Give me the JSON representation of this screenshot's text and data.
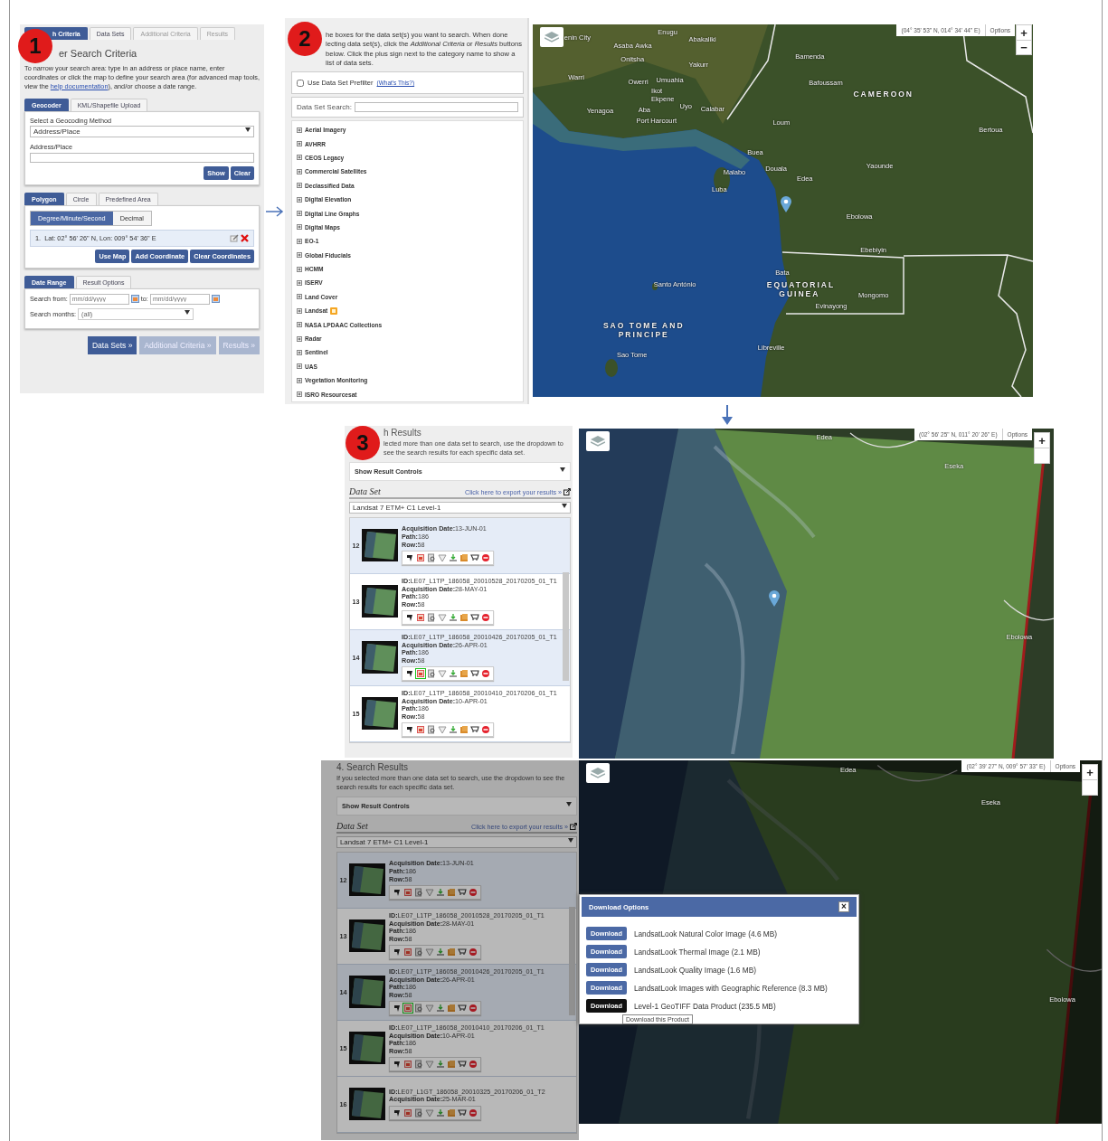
{
  "step1": {
    "badge": "1",
    "tabs": [
      {
        "label": "h Criteria",
        "selected": true,
        "disabled": false
      },
      {
        "label": "Data Sets",
        "selected": false,
        "disabled": false
      },
      {
        "label": "Additional Criteria",
        "selected": false,
        "disabled": true
      },
      {
        "label": "Results",
        "selected": false,
        "disabled": true
      }
    ],
    "title": "er Search Criteria",
    "intro_before": "To narrow your search area: type in an address or place name, enter coordinates or click the map to define your search area (for advanced map tools, view the ",
    "intro_link": "help documentation",
    "intro_after": "), and/or choose a date range.",
    "geocoder": {
      "tabs": [
        {
          "label": "Geocoder",
          "selected": true
        },
        {
          "label": "KML/Shapefile Upload",
          "selected": false
        }
      ],
      "method_label": "Select a Geocoding Method",
      "method_value": "Address/Place",
      "field_label": "Address/Place",
      "buttons": [
        "Show",
        "Clear"
      ]
    },
    "area": {
      "tabs": [
        {
          "label": "Polygon",
          "selected": true
        },
        {
          "label": "Circle",
          "selected": false
        },
        {
          "label": "Predefined Area",
          "selected": false
        }
      ],
      "formats": [
        {
          "label": "Degree/Minute/Second",
          "selected": true
        },
        {
          "label": "Decimal",
          "selected": false
        }
      ],
      "coordinates": [
        {
          "index": "1.",
          "text": "Lat: 02° 56' 26\" N, Lon: 009° 54' 36\" E"
        }
      ],
      "buttons": [
        "Use Map",
        "Add Coordinate",
        "Clear Coordinates"
      ]
    },
    "dates": {
      "tabs": [
        {
          "label": "Date Range",
          "selected": true
        },
        {
          "label": "Result Options",
          "selected": false
        }
      ],
      "from_label": "Search from:",
      "from_placeholder": "mm/dd/yyyy",
      "to_label": "to:",
      "to_placeholder": "mm/dd/yyyy",
      "months_label": "Search months:",
      "months_value": "(all)"
    },
    "nav_buttons": [
      {
        "label": "Data Sets »",
        "disabled": false
      },
      {
        "label": "Additional Criteria »",
        "disabled": true
      },
      {
        "label": "Results »",
        "disabled": true
      }
    ]
  },
  "step2": {
    "badge": "2",
    "intro": "he boxes for the data set(s) you want to search. When done lecting data set(s), click the *Additional Criteria* or *Results* buttons below. Click the plus sign next to the category name to show a list of data sets.",
    "prefilter": {
      "label": "Use Data Set Prefilter",
      "checked": false,
      "link": "(What's This?)"
    },
    "search_label": "Data Set Search:",
    "categories": [
      {
        "label": "Aerial Imagery",
        "new": false
      },
      {
        "label": "AVHRR",
        "new": false
      },
      {
        "label": "CEOS Legacy",
        "new": false
      },
      {
        "label": "Commercial Satellites",
        "new": false
      },
      {
        "label": "Declassified Data",
        "new": false
      },
      {
        "label": "Digital Elevation",
        "new": false
      },
      {
        "label": "Digital Line Graphs",
        "new": false
      },
      {
        "label": "Digital Maps",
        "new": false
      },
      {
        "label": "EO-1",
        "new": false
      },
      {
        "label": "Global Fiducials",
        "new": false
      },
      {
        "label": "HCMM",
        "new": false
      },
      {
        "label": "ISERV",
        "new": false
      },
      {
        "label": "Land Cover",
        "new": false
      },
      {
        "label": "Landsat",
        "new": true
      },
      {
        "label": "NASA LPDAAC Collections",
        "new": false
      },
      {
        "label": "Radar",
        "new": false
      },
      {
        "label": "Sentinel",
        "new": false
      },
      {
        "label": "UAS",
        "new": false
      },
      {
        "label": "Vegetation Monitoring",
        "new": false
      },
      {
        "label": "ISRO Resourcesat",
        "new": false
      }
    ],
    "map": {
      "coordinates": "(04° 35' 53\" N, 014° 34' 44\" E)",
      "options": "Options",
      "zoom_in": "+",
      "zoom_out": "−",
      "labels": [
        {
          "text": "enin City",
          "kind": "city"
        },
        {
          "text": "Enugu",
          "kind": "city"
        },
        {
          "text": "Asaba",
          "kind": "city"
        },
        {
          "text": "Awka",
          "kind": "city"
        },
        {
          "text": "Abakaliki",
          "kind": "city"
        },
        {
          "text": "Onitsha",
          "kind": "city"
        },
        {
          "text": "Yakurr",
          "kind": "city"
        },
        {
          "text": "Warri",
          "kind": "city"
        },
        {
          "text": "Owerri",
          "kind": "city"
        },
        {
          "text": "Umuahia",
          "kind": "city"
        },
        {
          "text": "Ikot Ekpene",
          "kind": "city"
        },
        {
          "text": "Uyo",
          "kind": "city"
        },
        {
          "text": "Calabar",
          "kind": "city"
        },
        {
          "text": "Yenagoa",
          "kind": "city"
        },
        {
          "text": "Aba",
          "kind": "city"
        },
        {
          "text": "Port Harcourt",
          "kind": "city"
        },
        {
          "text": "Bamenda",
          "kind": "city"
        },
        {
          "text": "Bafoussam",
          "kind": "city"
        },
        {
          "text": "CAMEROON",
          "kind": "country"
        },
        {
          "text": "Loum",
          "kind": "city"
        },
        {
          "text": "Bertoua",
          "kind": "city"
        },
        {
          "text": "Buea",
          "kind": "city"
        },
        {
          "text": "Douala",
          "kind": "city"
        },
        {
          "text": "Edea",
          "kind": "city"
        },
        {
          "text": "Malabo",
          "kind": "city"
        },
        {
          "text": "Luba",
          "kind": "city"
        },
        {
          "text": "Yaounde",
          "kind": "city"
        },
        {
          "text": "Ebolowa",
          "kind": "city"
        },
        {
          "text": "Ebebiyin",
          "kind": "city"
        },
        {
          "text": "Bata",
          "kind": "city"
        },
        {
          "text": "EQUATORIAL GUINEA",
          "kind": "country"
        },
        {
          "text": "Mongomo",
          "kind": "city"
        },
        {
          "text": "Evinayong",
          "kind": "city"
        },
        {
          "text": "Santo António",
          "kind": "city"
        },
        {
          "text": "SAO TOME AND PRINCIPE",
          "kind": "country"
        },
        {
          "text": "Sao Tome",
          "kind": "city"
        },
        {
          "text": "Libreville",
          "kind": "city"
        }
      ]
    }
  },
  "step3": {
    "results": {
      "badge": "3",
      "title": "h Results",
      "intro": "lected more than one data set to search, use the dropdown to see the search results for each specific data set.",
      "controls": "Show Result Controls",
      "dataset_label": "Data Set",
      "export_link": "Click here to export your results »",
      "dataset_value": "Landsat 7 ETM+ C1 Level-1",
      "rows": [
        {
          "number": "12",
          "selected": true,
          "browse_on": false,
          "fields": [
            {
              "label": "Acquisition Date:",
              "value": "13-JUN-01"
            },
            {
              "label": "Path:",
              "value": "186"
            },
            {
              "label": "Row:",
              "value": "58"
            }
          ]
        },
        {
          "number": "13",
          "selected": false,
          "browse_on": false,
          "fields": [
            {
              "label": "ID:",
              "value": "LE07_L1TP_186058_20010528_20170205_01_T1"
            },
            {
              "label": "Acquisition Date:",
              "value": "28-MAY-01"
            },
            {
              "label": "Path:",
              "value": "186"
            },
            {
              "label": "Row:",
              "value": "58"
            }
          ]
        },
        {
          "number": "14",
          "selected": true,
          "browse_on": true,
          "fields": [
            {
              "label": "ID:",
              "value": "LE07_L1TP_186058_20010426_20170205_01_T1"
            },
            {
              "label": "Acquisition Date:",
              "value": "26-APR-01"
            },
            {
              "label": "Path:",
              "value": "186"
            },
            {
              "label": "Row:",
              "value": "58"
            }
          ]
        },
        {
          "number": "15",
          "selected": false,
          "browse_on": false,
          "fields": [
            {
              "label": "ID:",
              "value": "LE07_L1TP_186058_20010410_20170206_01_T1"
            },
            {
              "label": "Acquisition Date:",
              "value": "10-APR-01"
            },
            {
              "label": "Path:",
              "value": "186"
            },
            {
              "label": "Row:",
              "value": "58"
            }
          ]
        }
      ]
    },
    "map": {
      "coordinates": "(02° 56' 25\" N, 011° 20' 26\" E)",
      "options": "Options",
      "zoom_in": "+",
      "labels": [
        {
          "text": "Edea",
          "kind": "city"
        },
        {
          "text": "Eseka",
          "kind": "city"
        },
        {
          "text": "Ebolowa",
          "kind": "city"
        }
      ]
    }
  },
  "step4": {
    "dimmed": true,
    "results": {
      "title": "4. Search Results",
      "intro": "If you selected more than one data set to search, use the dropdown to see the search results for each specific data set.",
      "controls": "Show Result Controls",
      "dataset_label": "Data Set",
      "export_link": "Click here to export your results »",
      "dataset_value": "Landsat 7 ETM+ C1 Level-1",
      "rows": [
        {
          "number": "12",
          "selected": true,
          "browse_on": false,
          "fields": [
            {
              "label": "Acquisition Date:",
              "value": "13-JUN-01"
            },
            {
              "label": "Path:",
              "value": "186"
            },
            {
              "label": "Row:",
              "value": "58"
            }
          ]
        },
        {
          "number": "13",
          "selected": false,
          "browse_on": false,
          "fields": [
            {
              "label": "ID:",
              "value": "LE07_L1TP_186058_20010528_20170205_01_T1"
            },
            {
              "label": "Acquisition Date:",
              "value": "28-MAY-01"
            },
            {
              "label": "Path:",
              "value": "186"
            },
            {
              "label": "Row:",
              "value": "58"
            }
          ]
        },
        {
          "number": "14",
          "selected": true,
          "browse_on": true,
          "fields": [
            {
              "label": "ID:",
              "value": "LE07_L1TP_186058_20010426_20170205_01_T1"
            },
            {
              "label": "Acquisition Date:",
              "value": "26-APR-01"
            },
            {
              "label": "Path:",
              "value": "186"
            },
            {
              "label": "Row:",
              "value": "58"
            }
          ]
        },
        {
          "number": "15",
          "selected": false,
          "browse_on": false,
          "fields": [
            {
              "label": "ID:",
              "value": "LE07_L1TP_186058_20010410_20170206_01_T1"
            },
            {
              "label": "Acquisition Date:",
              "value": "10-APR-01"
            },
            {
              "label": "Path:",
              "value": "186"
            },
            {
              "label": "Row:",
              "value": "58"
            }
          ]
        },
        {
          "number": "16",
          "selected": false,
          "browse_on": false,
          "fields": [
            {
              "label": "ID:",
              "value": "LE07_L1GT_186058_20010325_20170206_01_T2"
            },
            {
              "label": "Acquisition Date:",
              "value": "25-MAR-01"
            }
          ]
        }
      ]
    },
    "map": {
      "coordinates": "(02° 39' 27\" N, 009° 57' 33\" E)",
      "options": "Options",
      "zoom_in": "+",
      "labels": [
        {
          "text": "Edea",
          "kind": "city"
        },
        {
          "text": "Eseka",
          "kind": "city"
        },
        {
          "text": "Ebolowa",
          "kind": "city"
        }
      ]
    },
    "dialog": {
      "title": "Download Options",
      "close": "×",
      "options": [
        {
          "button": "Download",
          "label": "LandsatLook Natural Color Image (4.6 MB)",
          "hovered": false
        },
        {
          "button": "Download",
          "label": "LandsatLook Thermal Image (2.1 MB)",
          "hovered": false
        },
        {
          "button": "Download",
          "label": "LandsatLook Quality Image (1.6 MB)",
          "hovered": false
        },
        {
          "button": "Download",
          "label": "LandsatLook Images with Geographic Reference (8.3 MB)",
          "hovered": false
        },
        {
          "button": "Download",
          "label": "Level-1 GeoTIFF Data Product (235.5 MB)",
          "hovered": true
        }
      ],
      "tooltip": "Download this Product"
    }
  }
}
